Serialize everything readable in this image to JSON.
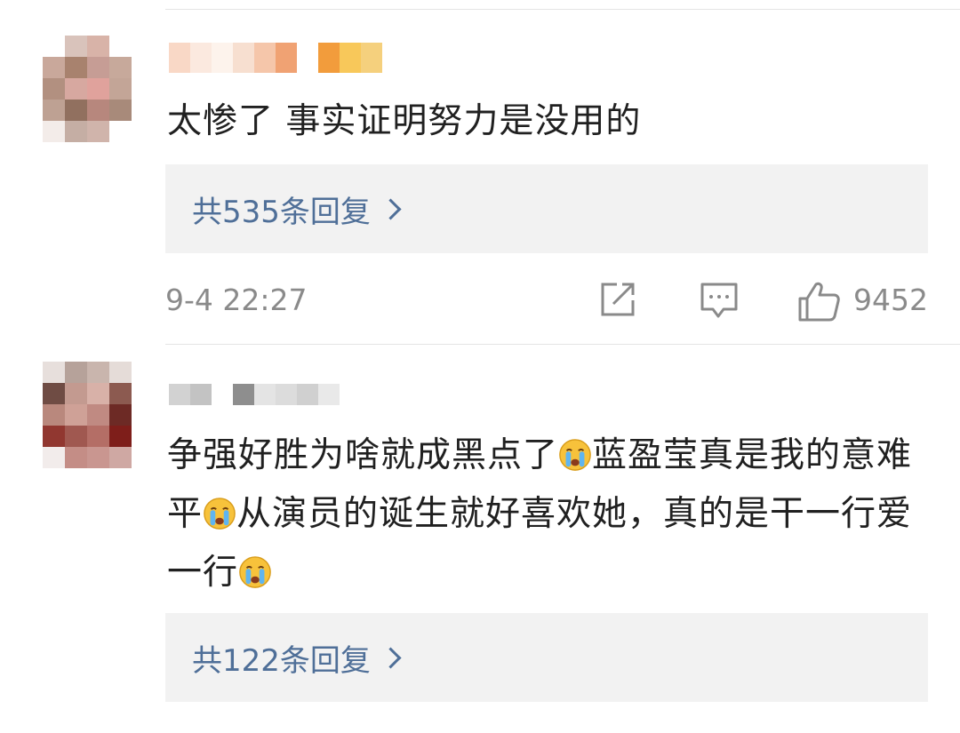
{
  "comments": [
    {
      "text": "太惨了 事实证明努力是没用的",
      "replies_label": "共535条回复",
      "timestamp": "9-4 22:27",
      "like_count": "9452"
    },
    {
      "text_parts": [
        "争强好胜为啥就成黑点了",
        "蓝盈莹真是我的意难平",
        "从演员的诞生就好喜欢她，真的是干一行爱一行"
      ],
      "emoji_name": "crying-face-icon",
      "replies_label": "共122条回复"
    }
  ],
  "icons": {
    "share": "share-icon",
    "comment": "comment-icon",
    "like": "thumbs-up-icon",
    "chevron": "chevron-right-icon"
  },
  "colors": {
    "link": "#4f6f98",
    "meta": "#8a8a8a",
    "reply_bg": "#f2f2f2"
  }
}
